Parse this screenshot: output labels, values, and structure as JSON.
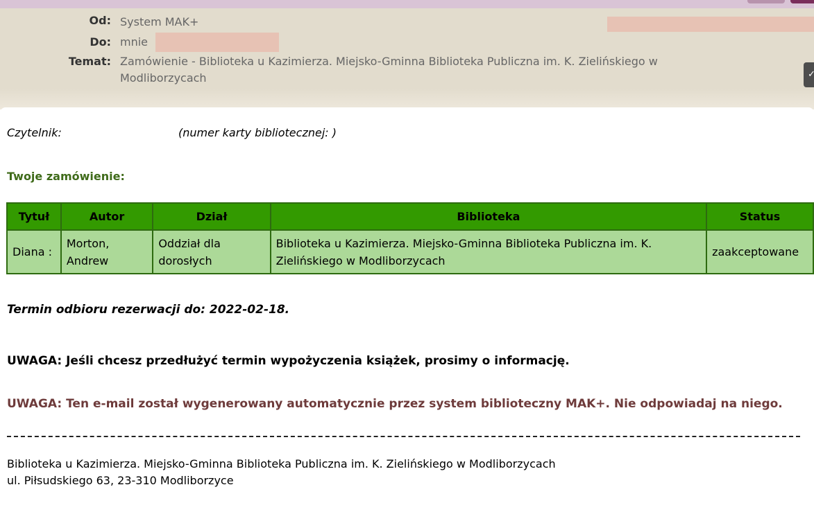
{
  "header": {
    "from_label": "Od:",
    "from_value": "System MAK+",
    "to_label": "Do:",
    "to_value": "mnie",
    "subject_label": "Temat:",
    "subject_value": "Zamówienie - Biblioteka u Kazimierza. Miejsko-Gminna Biblioteka Publiczna im. K. Zielińskiego w Modliborzycach",
    "side_button": "✓"
  },
  "body": {
    "reader_label": "Czytelnik:",
    "card_label": "(numer karty bibliotecznej:               )",
    "order_heading": "Twoje zamówienie:",
    "table": {
      "headers": [
        "Tytuł",
        "Autor",
        "Dział",
        "Biblioteka",
        "Status"
      ],
      "row": [
        "Diana :",
        "Morton, Andrew",
        "Oddział dla dorosłych",
        "Biblioteka u Kazimierza. Miejsko-Gminna Biblioteka Publiczna im. K. Zielińskiego w Modliborzycach",
        "zaakceptowane"
      ]
    },
    "deadline": "Termin odbioru rezerwacji do: 2022-02-18.",
    "notice_extend": "UWAGA: Jeśli chcesz przedłużyć termin wypożyczenia książek, prosimy o informację.",
    "notice_auto": "UWAGA: Ten e-mail został wygenerowany automatycznie przez system biblioteczny MAK+. Nie odpowiadaj na niego.",
    "footer_line1": "Biblioteka u Kazimierza. Miejsko-Gminna Biblioteka Publiczna im. K. Zielińskiego w Modliborzycach",
    "footer_line2": "ul. Piłsudskiego 63, 23-310 Modliborzyce"
  },
  "colors": {
    "header_bg": "#e2dccd",
    "table_header": "#339a00",
    "table_cell": "#acd998",
    "heading_green": "#3f6b1a",
    "notice_red": "#6e3b3b"
  }
}
